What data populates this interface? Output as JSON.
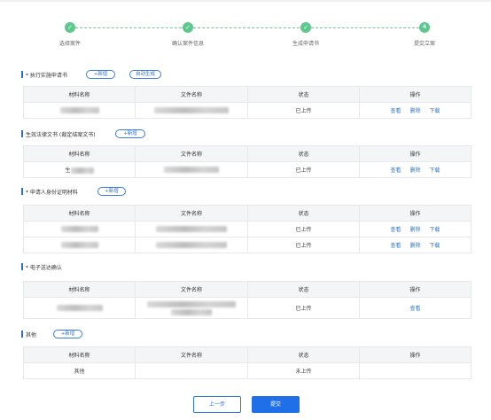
{
  "steps": [
    {
      "label": "选择案件",
      "state": "done"
    },
    {
      "label": "确认案件信息",
      "state": "done"
    },
    {
      "label": "生成申请书",
      "state": "done"
    },
    {
      "label": "提交立案",
      "state": "current",
      "number": "4"
    }
  ],
  "sections": {
    "exec": {
      "title": "* 执行实施申请书",
      "add_label": "+新增",
      "auto_label": "自动生成"
    },
    "legal": {
      "title": "生效法律文书 (裁定结案文书)",
      "add_label": "+新增"
    },
    "identity": {
      "title": "* 申请人身份证明材料",
      "add_label": "+新增"
    },
    "esign": {
      "title": "* 电子送达确认"
    },
    "other": {
      "title": "其他",
      "add_label": "+新增"
    }
  },
  "table_headers": {
    "material": "材料名称",
    "file": "文件名称",
    "status": "状态",
    "ops": "操作"
  },
  "rows": {
    "exec": [
      {
        "material": "",
        "file": "",
        "status": "已上传",
        "ops": [
          "查看",
          "删除",
          "下载"
        ]
      }
    ],
    "legal": [
      {
        "material": "生",
        "file": "",
        "status": "已上传",
        "ops": [
          "查看",
          "删除",
          "下载"
        ]
      }
    ],
    "identity": [
      {
        "material": "",
        "file": "",
        "status": "已上传",
        "ops": [
          "查看",
          "删除",
          "下载"
        ]
      },
      {
        "material": "",
        "file": "",
        "status": "已上传",
        "ops": [
          "查看",
          "删除",
          "下载"
        ]
      }
    ],
    "esign": [
      {
        "material": "",
        "file": "",
        "status": "已上传",
        "ops": [
          "查看"
        ]
      }
    ],
    "other": [
      {
        "material": "其他",
        "file": "",
        "status": "未上传",
        "ops": []
      }
    ]
  },
  "buttons": {
    "prev": "上一步",
    "submit": "提交"
  },
  "colors": {
    "done": "#5cc88d",
    "accent": "#1f6fe8",
    "uploaded": "#5ab836",
    "not_uploaded": "#e03a3a"
  }
}
